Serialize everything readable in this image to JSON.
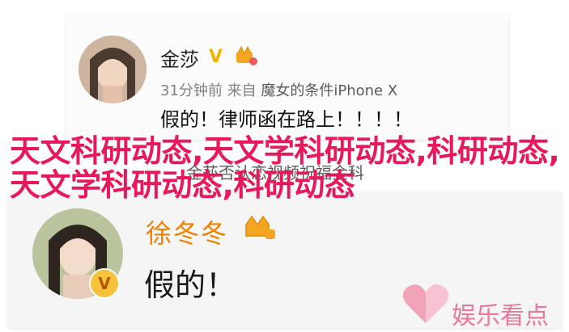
{
  "post1": {
    "username": "金莎",
    "verified_mark": "V",
    "meta_time": "31分钟前",
    "meta_from": "来自",
    "meta_source": "魔女的条件iPhone X",
    "content": "假的！律师函在路上！！！！"
  },
  "overlay_text": "天文科研动态,天文学科研动态,科研动态,天文学科研动态,科研动态",
  "ghost_text": "金莎否认恋视频祝福金科",
  "post2": {
    "username": "徐冬冬",
    "content": "假的！",
    "verified_mark": "V"
  },
  "watermark": "娱乐看点",
  "colors": {
    "overlay": "#e8195b",
    "name2": "#f08000",
    "watermark": "#ea7899",
    "vip_gold": "#f0b400"
  },
  "icons": [
    "verified-v-icon",
    "vip-crown-icon",
    "heart-logo-icon"
  ]
}
